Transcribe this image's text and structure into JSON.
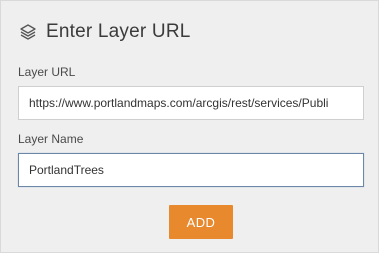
{
  "header": {
    "icon": "layers-icon",
    "title": "Enter Layer URL"
  },
  "form": {
    "url_label": "Layer URL",
    "url_value": "https://www.portlandmaps.com/arcgis/rest/services/Publi",
    "name_label": "Layer Name",
    "name_value": "PortlandTrees",
    "add_label": "ADD"
  },
  "colors": {
    "panel_background": "#efefef",
    "accent_button": "#e8892e",
    "focused_border": "#6c88a8"
  }
}
